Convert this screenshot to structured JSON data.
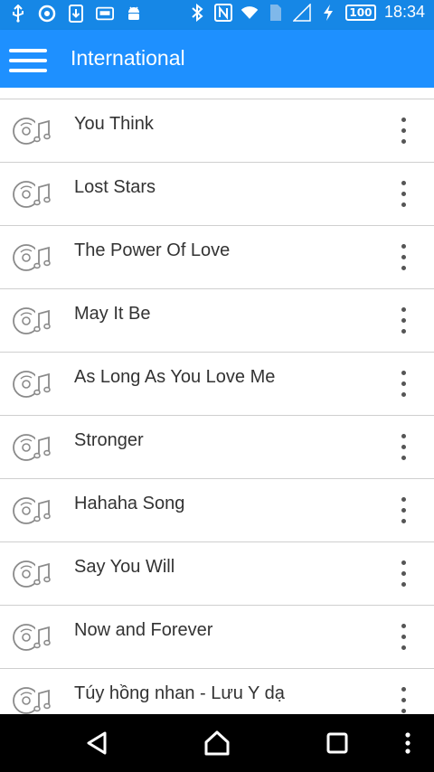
{
  "status_bar": {
    "battery": "100",
    "time": "18:34",
    "icons": [
      "usb-icon",
      "record-icon",
      "download-icon",
      "keyboard-icon",
      "android-icon",
      "bluetooth-icon",
      "nfc-icon",
      "wifi-icon",
      "sim-icon",
      "signal-icon",
      "charging-icon",
      "battery-icon"
    ]
  },
  "app_bar": {
    "title": "International",
    "menu_icon": "hamburger-menu-icon"
  },
  "songs": [
    {
      "title": "You Think"
    },
    {
      "title": "Lost Stars"
    },
    {
      "title": "The Power Of Love"
    },
    {
      "title": "May It Be"
    },
    {
      "title": "As Long As You Love Me"
    },
    {
      "title": "Stronger"
    },
    {
      "title": "Hahaha Song"
    },
    {
      "title": "Say You Will"
    },
    {
      "title": "Now and Forever"
    },
    {
      "title": "Túy hồng nhan - Lưu Y dạ"
    }
  ],
  "nav_bar": {
    "icons": [
      "back-icon",
      "home-icon",
      "recents-icon",
      "more-icon"
    ]
  }
}
